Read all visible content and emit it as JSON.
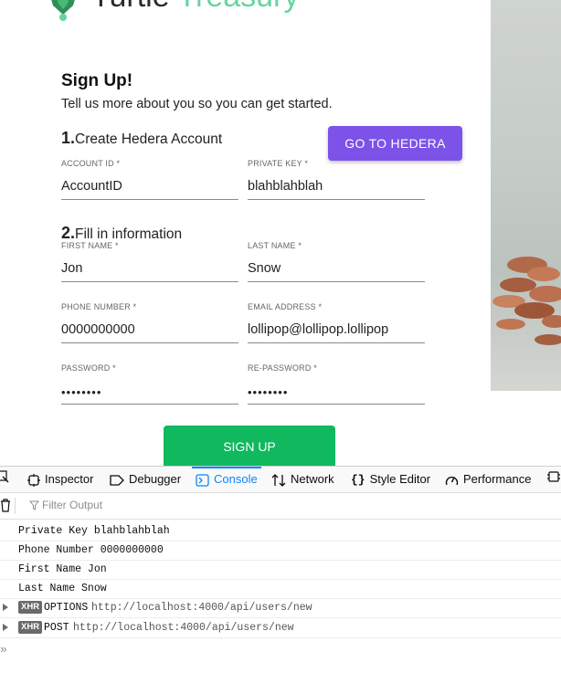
{
  "logo": {
    "brand_part1": "Turtle",
    "brand_part2": "Treasury",
    "icon": "turtle-icon",
    "accent": "#66d49e"
  },
  "form": {
    "title": "Sign Up!",
    "subtitle": "Tell us more about you so you can get started.",
    "section1": {
      "num": "1.",
      "label": "Create Hedera Account"
    },
    "section2": {
      "num": "2.",
      "label": "Fill in information"
    },
    "hedera_button": "GO TO HEDERA",
    "signup_button": "SIGN UP",
    "fields": {
      "account_id": {
        "label": "ACCOUNT ID *",
        "value": "AccountID"
      },
      "private_key": {
        "label": "PRIVATE KEY *",
        "value": "blahblahblah"
      },
      "first_name": {
        "label": "FIRST NAME *",
        "value": "Jon"
      },
      "last_name": {
        "label": "LAST NAME *",
        "value": "Snow"
      },
      "phone": {
        "label": "PHONE NUMBER *",
        "value": "0000000000"
      },
      "email": {
        "label": "EMAIL ADDRESS *",
        "value": "lollipop@lollipop.lollipop"
      },
      "password": {
        "label": "PASSWORD *",
        "value": "••••••••"
      },
      "repassword": {
        "label": "RE-PASSWORD *",
        "value": "••••••••"
      }
    },
    "colors": {
      "hedera": "#7c52e8",
      "signup": "#10b85e"
    }
  },
  "devtools": {
    "tabs": [
      {
        "label": "Inspector",
        "icon": "inspector-icon"
      },
      {
        "label": "Debugger",
        "icon": "debugger-icon"
      },
      {
        "label": "Console",
        "icon": "console-icon",
        "active": true
      },
      {
        "label": "Network",
        "icon": "network-icon"
      },
      {
        "label": "Style Editor",
        "icon": "style-editor-icon"
      },
      {
        "label": "Performance",
        "icon": "performance-icon"
      }
    ],
    "filter_placeholder": "Filter Output",
    "logs": [
      "Private Key blahblahblah",
      "Phone Number 0000000000",
      "First Name Jon",
      "Last Name Snow"
    ],
    "requests": [
      {
        "badge": "XHR",
        "method": "OPTIONS",
        "url": "http://localhost:4000/api/users/new"
      },
      {
        "badge": "XHR",
        "method": "POST",
        "url": "http://localhost:4000/api/users/new"
      }
    ],
    "prompt": "»",
    "accent": "#0a84ff"
  }
}
